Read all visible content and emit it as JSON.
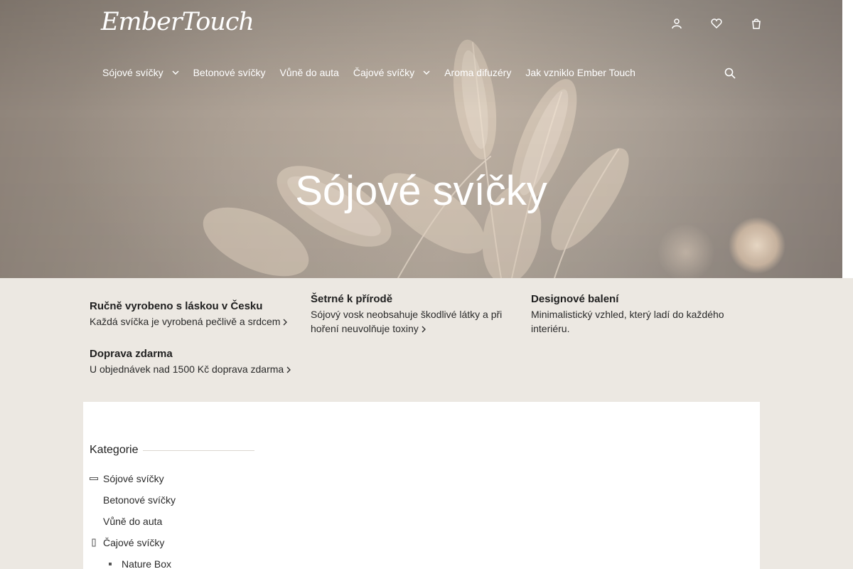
{
  "brand": {
    "logo_text": "EmberTouch"
  },
  "header": {
    "icons": [
      {
        "name": "account-icon"
      },
      {
        "name": "wishlist-icon"
      },
      {
        "name": "cart-icon"
      }
    ]
  },
  "nav": {
    "items": [
      {
        "label": "Sójové svíčky",
        "has_dropdown": true
      },
      {
        "label": "Betonové svíčky",
        "has_dropdown": false
      },
      {
        "label": "Vůně do auta",
        "has_dropdown": false
      },
      {
        "label": "Čajové svíčky",
        "has_dropdown": true
      },
      {
        "label": "Aroma difuzéry",
        "has_dropdown": false
      },
      {
        "label": "Jak vzniklo Ember Touch",
        "has_dropdown": false
      }
    ],
    "search_icon": "search-icon"
  },
  "hero": {
    "title": "Sójové svíčky"
  },
  "benefits": [
    {
      "title": "Ručně vyrobeno s láskou v Česku",
      "text": "Každá svíčka je vyrobená pečlivě a srdcem"
    },
    {
      "title": "Šetrné k přírodě",
      "text": "Sójový vosk neobsahuje škodlivé látky a při hoření neuvolňuje toxiny"
    },
    {
      "title": "Designové balení",
      "text": "Minimalistický vzhled, který ladí do každého interiéru."
    },
    {
      "title": "Doprava zdarma",
      "text": "U objednávek nad 1500 Kč doprava zdarma"
    }
  ],
  "sidebar": {
    "heading": "Kategorie",
    "categories": [
      {
        "label": "Sójové svíčky",
        "state": "expanded"
      },
      {
        "label": "Betonové svíčky",
        "state": "none"
      },
      {
        "label": "Vůně do auta",
        "state": "none"
      },
      {
        "label": "Čajové svíčky",
        "state": "collapsed"
      },
      {
        "label": "Nature Box",
        "state": "child"
      }
    ]
  },
  "colors": {
    "page_background": "#ece8e2",
    "panel_background": "#ffffff",
    "hero_text": "#ffffff",
    "body_text": "#1f1f1f"
  }
}
